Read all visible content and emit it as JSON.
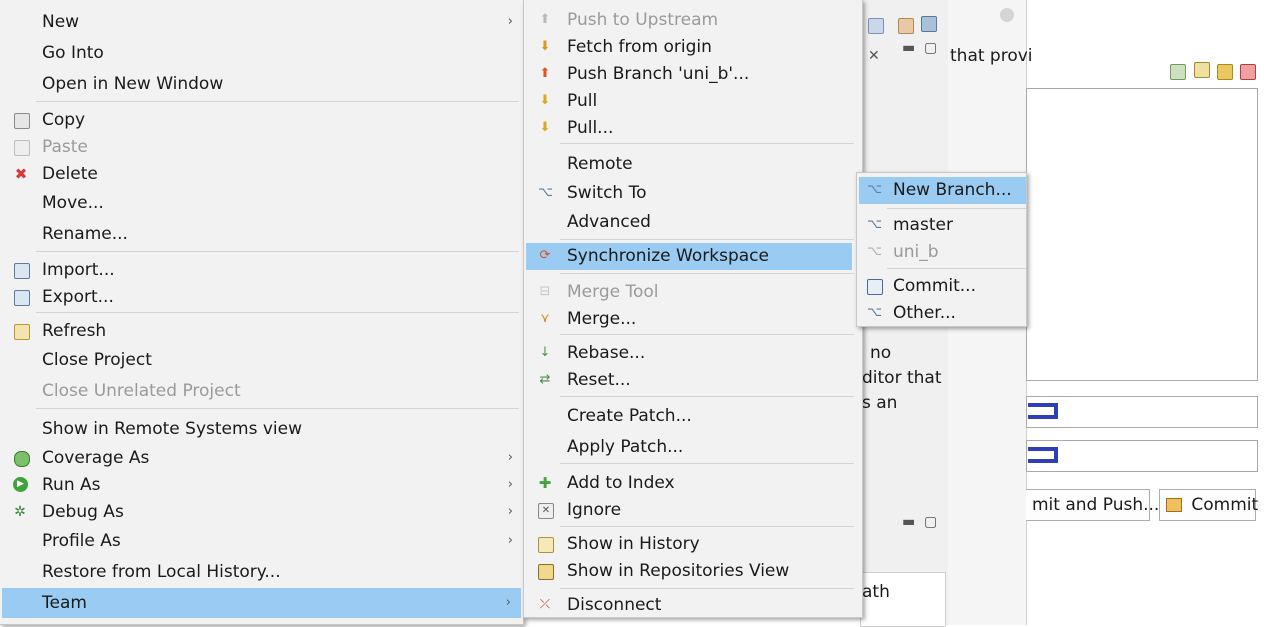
{
  "background": {
    "snippet_top": "that provi",
    "snippet_mid1": "no",
    "snippet_mid2": "ditor that",
    "snippet_mid3": "s an",
    "snippet_bottom": "ath",
    "commit_and_push_label": "mit and Push...",
    "commit_label": "Commit"
  },
  "main_menu": {
    "items": [
      {
        "label": "New"
      },
      {
        "label": "Go Into"
      },
      {
        "label": "Open in New Window"
      },
      {
        "label": "Copy"
      },
      {
        "label": "Paste"
      },
      {
        "label": "Delete"
      },
      {
        "label": "Move..."
      },
      {
        "label": "Rename..."
      },
      {
        "label": "Import..."
      },
      {
        "label": "Export..."
      },
      {
        "label": "Refresh"
      },
      {
        "label": "Close Project"
      },
      {
        "label": "Close Unrelated Project"
      },
      {
        "label": "Show in Remote Systems view"
      },
      {
        "label": "Coverage As"
      },
      {
        "label": "Run As"
      },
      {
        "label": "Debug As"
      },
      {
        "label": "Profile As"
      },
      {
        "label": "Restore from Local History..."
      },
      {
        "label": "Team"
      }
    ]
  },
  "team_menu": {
    "items": [
      {
        "label": "Push to Upstream"
      },
      {
        "label": "Fetch from origin"
      },
      {
        "label": "Push Branch 'uni_b'..."
      },
      {
        "label": "Pull"
      },
      {
        "label": "Pull..."
      },
      {
        "label": "Remote"
      },
      {
        "label": "Switch To"
      },
      {
        "label": "Advanced"
      },
      {
        "label": "Synchronize Workspace"
      },
      {
        "label": "Merge Tool"
      },
      {
        "label": "Merge..."
      },
      {
        "label": "Rebase..."
      },
      {
        "label": "Reset..."
      },
      {
        "label": "Create Patch..."
      },
      {
        "label": "Apply Patch..."
      },
      {
        "label": "Add to Index"
      },
      {
        "label": "Ignore"
      },
      {
        "label": "Show in History"
      },
      {
        "label": "Show in Repositories View"
      },
      {
        "label": "Disconnect"
      }
    ]
  },
  "switch_menu": {
    "items": [
      {
        "label": "New Branch..."
      },
      {
        "label": "master"
      },
      {
        "label": "uni_b"
      },
      {
        "label": "Commit..."
      },
      {
        "label": "Other..."
      }
    ]
  },
  "colors": {
    "selection": "#99cbf3",
    "menu_bg": "#f2f2f2",
    "disabled_text": "#9a9a9a"
  }
}
